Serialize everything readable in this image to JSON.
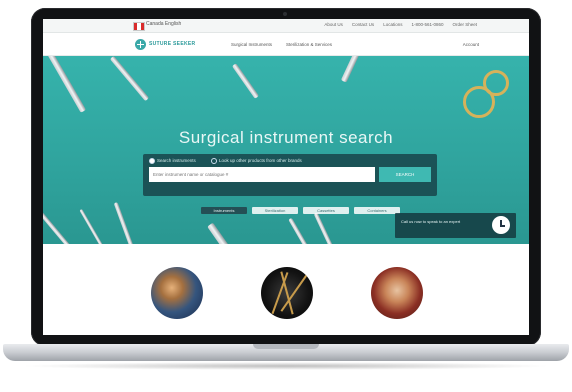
{
  "topbar": {
    "language": "Canada English",
    "links": [
      "About Us",
      "Contact Us",
      "Locations",
      "1-800-561-0860",
      "Order Sheet"
    ]
  },
  "nav": {
    "logo_text": "SUTURE SEEKER",
    "menu": [
      "Surgical Instruments",
      "Sterilization & Services"
    ],
    "account": "Account"
  },
  "hero": {
    "title": "Surgical instrument search",
    "radio_options": [
      "Search instruments",
      "Look up other products from other brands"
    ],
    "search_placeholder": "Enter instrument name or catalogue #",
    "search_button": "SEARCH",
    "chips": [
      "Instruments",
      "Sterilization",
      "Cassettes",
      "Containers"
    ],
    "promo_text": "Call us now to speak to an expert"
  },
  "colors": {
    "hero_bg": "#36b3ac",
    "accent": "#3fb9b2",
    "dark_panel": "#163c42"
  }
}
